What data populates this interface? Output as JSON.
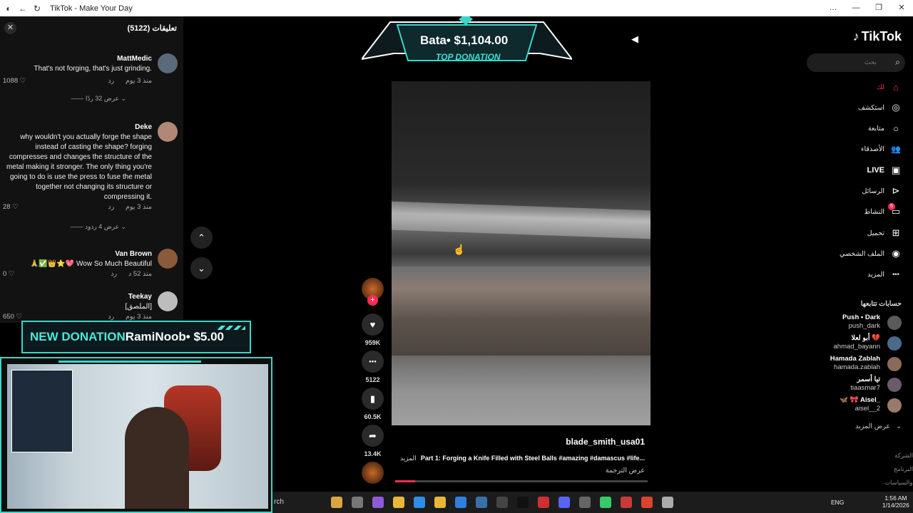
{
  "window": {
    "title": "TikTok - Make Your Day",
    "controls": [
      "…",
      "—",
      "❐",
      "✕"
    ]
  },
  "comments": {
    "title": "تعليقات (5122)",
    "close_icon": "close-icon",
    "items": [
      {
        "name": "MattMedic",
        "text": "That's not forging, that's just grinding.",
        "time": "منذ 3 يوم",
        "reply": "رد",
        "likes": "1088",
        "replies": "عرض 32 ردًا",
        "avatar_color": "#5b6a7a"
      },
      {
        "name": "Deke",
        "text": "why wouldn't you actually forge the shape instead of casting the shape? forging compresses and changes the structure of the metal making it stronger. The only thing you're going to do is use the press to fuse the metal together not changing its structure or compressing it.",
        "time": "منذ 3 يوم",
        "reply": "رد",
        "likes": "28",
        "replies": "عرض 4 ردود",
        "avatar_color": "#b08878"
      },
      {
        "name": "Van Brown",
        "text": "🙏✅👑⭐💖 Wow So Much Beautiful",
        "time": "منذ 52 د",
        "reply": "رد",
        "likes": "0",
        "avatar_color": "#8a5a3a"
      },
      {
        "name": "Teekay",
        "text": "[الملصق]",
        "time": "منذ 3 يوم",
        "reply": "رد",
        "likes": "650",
        "avatar_color": "#bdbdbd"
      }
    ]
  },
  "donation_top": {
    "line1": "Bata• $1,104.00",
    "line2": "TOP DONATION"
  },
  "donation_new": {
    "label": "NEW DONATION",
    "text": "RamiNoob• $5.00"
  },
  "video": {
    "author": "blade_smith_usa01",
    "caption": "Part 1: Forging a Knife Filled with Steel Balls #amazing #damascus #life...",
    "more": "المزيد",
    "translate": "عرض الترجمة",
    "progress": 0.08,
    "actions": [
      {
        "icon": "heart-icon",
        "glyph": "♥",
        "count": "959K"
      },
      {
        "icon": "comment-icon",
        "glyph": "●●●",
        "count": "5122"
      },
      {
        "icon": "bookmark-icon",
        "glyph": "▮",
        "count": "60.5K"
      },
      {
        "icon": "share-icon",
        "glyph": "➦",
        "count": "13.4K"
      }
    ]
  },
  "sidebar": {
    "logo": "TikTok",
    "search_placeholder": "بحث",
    "nav": [
      {
        "label": "لك",
        "icon": "home-icon",
        "glyph": "⌂",
        "active": true
      },
      {
        "label": "استكشف",
        "icon": "explore-icon",
        "glyph": "◎",
        "active": false
      },
      {
        "label": "متابعة",
        "icon": "following-icon",
        "glyph": "○",
        "active": false
      },
      {
        "label": "الأصدقاء",
        "icon": "friends-icon",
        "glyph": "👥",
        "active": false
      },
      {
        "label": "LIVE",
        "icon": "live-icon",
        "glyph": "▣",
        "active": false,
        "live": true
      },
      {
        "label": "الرسائل",
        "icon": "messages-icon",
        "glyph": "⊳",
        "active": false
      },
      {
        "label": "النشاط",
        "icon": "activity-icon",
        "glyph": "▭",
        "active": false,
        "badge": "5"
      },
      {
        "label": "تحميل",
        "icon": "upload-icon",
        "glyph": "⊞",
        "active": false
      },
      {
        "label": "الملف الشخصي",
        "icon": "profile-icon",
        "glyph": "◉",
        "active": false
      },
      {
        "label": "المزيد",
        "icon": "more-icon",
        "glyph": "•••",
        "active": false
      }
    ],
    "following_title": "حسابات تتابعها",
    "following": [
      {
        "name": "Push • Dark",
        "handle": "push_dark",
        "color": "#5a5a5a"
      },
      {
        "name": "أبو لعلا 💔",
        "handle": "ahmad_bayann",
        "color": "#4a6a8a"
      },
      {
        "name": "Hamada Zablah",
        "handle": "hamada.zablah",
        "color": "#8a6a5a"
      },
      {
        "name": "تيا أسمر",
        "handle": "tiaasmar7",
        "color": "#6a5a6a"
      },
      {
        "name": "🦋 🎀 Aisel_",
        "handle": "aisel__2",
        "color": "#9a7a6a"
      }
    ],
    "see_more": "عرض المزيد",
    "footer": [
      "الشركة",
      "البرنامج",
      "الشروط والسياسات"
    ]
  },
  "taskbar": {
    "search_text": "rch",
    "lang": "ENG",
    "time": "1:56 AM",
    "date": "1/14/2026",
    "app_colors": [
      "#d9a441",
      "#777",
      "#8f5ad6",
      "#e8b73a",
      "#2f8de4",
      "#e8b73a",
      "#2f7ee0",
      "#3b6fa8",
      "#444",
      "#111",
      "#d12f2f",
      "#5865f2",
      "#666",
      "#38c96a",
      "#c83a3a",
      "#d8442e",
      "#aaa"
    ]
  }
}
